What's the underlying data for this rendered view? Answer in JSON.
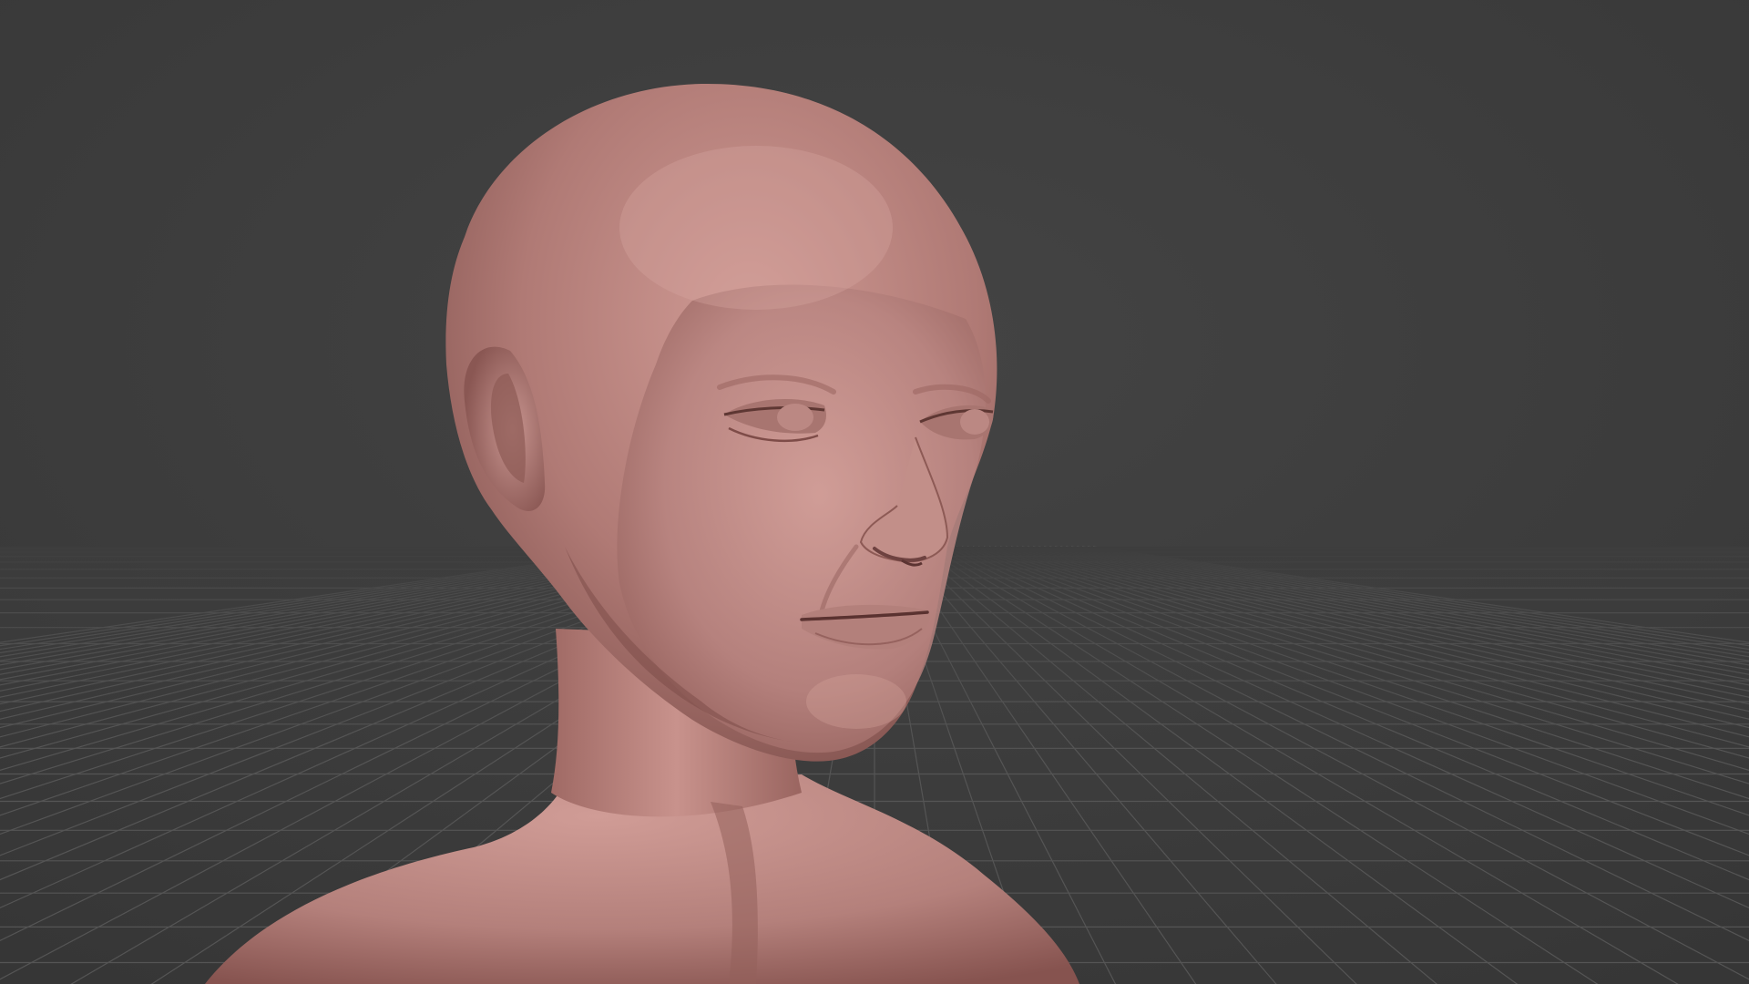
{
  "viewport": {
    "kind": "3d-viewport",
    "background_color": "#3d3d3d",
    "grid_line_color": "#555555",
    "grid_visible": true,
    "mesh": {
      "name": "head-bust-sculpt",
      "shading": "matcap clay",
      "base_color": "#b88480",
      "highlight_color": "#d6a49e",
      "shadow_color": "#6e4440"
    }
  }
}
